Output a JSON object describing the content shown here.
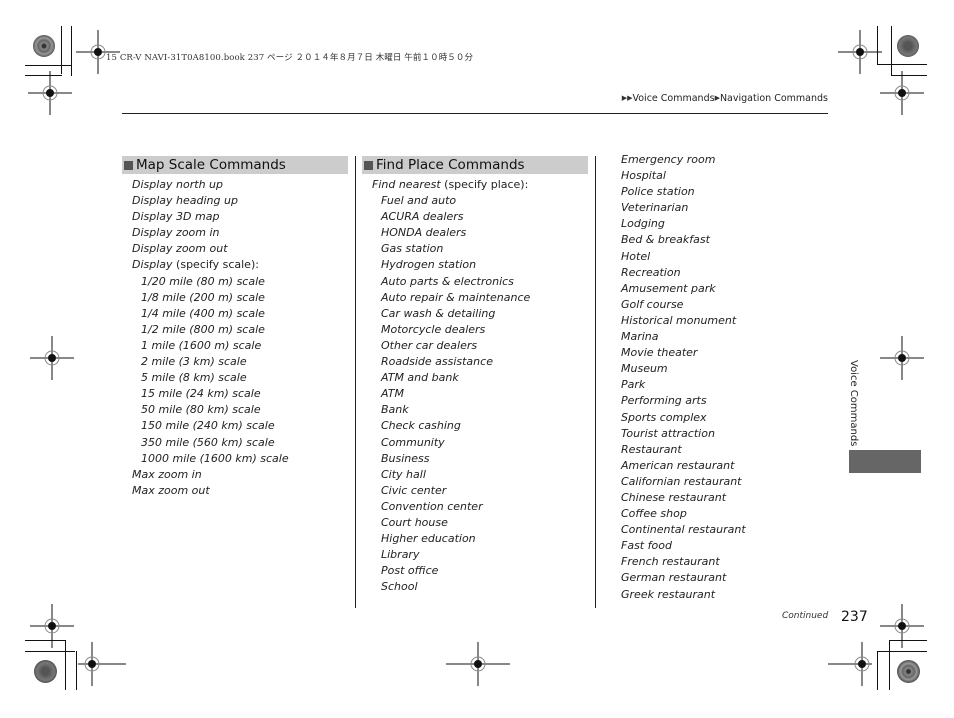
{
  "print_header": "15 CR-V NAVI-31T0A8100.book  237 ページ  ２０１４年８月７日  木曜日  午前１０時５０分",
  "breadcrumb": {
    "prefix_icon": "double-triangle-right-icon",
    "section": "Voice Commands",
    "separator_icon": "triangle-right-icon",
    "page": "Navigation Commands"
  },
  "columns": [
    {
      "heading": "Map Scale Commands",
      "items": [
        {
          "text": "Display north up",
          "level": 0
        },
        {
          "text": "Display heading up",
          "level": 0
        },
        {
          "text": "Display 3D map",
          "level": 0
        },
        {
          "text": "Display zoom in",
          "level": 0
        },
        {
          "text": "Display zoom out",
          "level": 0
        },
        {
          "text": "Display",
          "suffix": " (specify scale):",
          "level": 0
        },
        {
          "text": "1/20 mile (80 m) scale",
          "level": 1
        },
        {
          "text": "1/8 mile (200 m) scale",
          "level": 1
        },
        {
          "text": "1/4 mile (400 m) scale",
          "level": 1
        },
        {
          "text": "1/2 mile (800 m) scale",
          "level": 1
        },
        {
          "text": "1 mile (1600 m) scale",
          "level": 1
        },
        {
          "text": "2 mile (3 km) scale",
          "level": 1
        },
        {
          "text": "5 mile (8 km) scale",
          "level": 1
        },
        {
          "text": "15 mile (24 km) scale",
          "level": 1
        },
        {
          "text": "50 mile (80 km) scale",
          "level": 1
        },
        {
          "text": "150 mile (240 km) scale",
          "level": 1
        },
        {
          "text": "350 mile (560 km) scale",
          "level": 1
        },
        {
          "text": "1000 mile (1600 km) scale",
          "level": 1
        },
        {
          "text": "Max zoom in",
          "level": 0
        },
        {
          "text": "Max zoom out",
          "level": 0
        }
      ]
    },
    {
      "heading": "Find Place Commands",
      "items": [
        {
          "text": "Find nearest",
          "suffix": " (specify place):",
          "level": 0
        },
        {
          "text": "Fuel and auto",
          "level": 1
        },
        {
          "text": "ACURA dealers",
          "level": 1
        },
        {
          "text": "HONDA dealers",
          "level": 1
        },
        {
          "text": "Gas station",
          "level": 1
        },
        {
          "text": "Hydrogen station",
          "level": 1
        },
        {
          "text": "Auto parts & electronics",
          "level": 1
        },
        {
          "text": "Auto repair & maintenance",
          "level": 1
        },
        {
          "text": "Car wash & detailing",
          "level": 1
        },
        {
          "text": "Motorcycle dealers",
          "level": 1
        },
        {
          "text": "Other car dealers",
          "level": 1
        },
        {
          "text": "Roadside assistance",
          "level": 1
        },
        {
          "text": "ATM and bank",
          "level": 1
        },
        {
          "text": "ATM",
          "level": 1
        },
        {
          "text": "Bank",
          "level": 1
        },
        {
          "text": "Check cashing",
          "level": 1
        },
        {
          "text": "Community",
          "level": 1
        },
        {
          "text": "Business",
          "level": 1
        },
        {
          "text": "City hall",
          "level": 1
        },
        {
          "text": "Civic center",
          "level": 1
        },
        {
          "text": "Convention center",
          "level": 1
        },
        {
          "text": "Court house",
          "level": 1
        },
        {
          "text": "Higher education",
          "level": 1
        },
        {
          "text": "Library",
          "level": 1
        },
        {
          "text": "Post office",
          "level": 1
        },
        {
          "text": "School",
          "level": 1
        }
      ]
    },
    {
      "heading": "",
      "items": [
        {
          "text": "Emergency room",
          "level": 1
        },
        {
          "text": "Hospital",
          "level": 1
        },
        {
          "text": "Police station",
          "level": 1
        },
        {
          "text": "Veterinarian",
          "level": 1
        },
        {
          "text": "Lodging",
          "level": 1
        },
        {
          "text": "Bed & breakfast",
          "level": 1
        },
        {
          "text": "Hotel",
          "level": 1
        },
        {
          "text": "Recreation",
          "level": 1
        },
        {
          "text": "Amusement park",
          "level": 1
        },
        {
          "text": "Golf course",
          "level": 1
        },
        {
          "text": "Historical monument",
          "level": 1
        },
        {
          "text": "Marina",
          "level": 1
        },
        {
          "text": "Movie theater",
          "level": 1
        },
        {
          "text": "Museum",
          "level": 1
        },
        {
          "text": "Park",
          "level": 1
        },
        {
          "text": "Performing arts",
          "level": 1
        },
        {
          "text": "Sports complex",
          "level": 1
        },
        {
          "text": "Tourist attraction",
          "level": 1
        },
        {
          "text": "Restaurant",
          "level": 1
        },
        {
          "text": "American restaurant",
          "level": 1
        },
        {
          "text": "Californian restaurant",
          "level": 1
        },
        {
          "text": "Chinese restaurant",
          "level": 1
        },
        {
          "text": "Coffee shop",
          "level": 1
        },
        {
          "text": "Continental restaurant",
          "level": 1
        },
        {
          "text": "Fast food",
          "level": 1
        },
        {
          "text": "French restaurant",
          "level": 1
        },
        {
          "text": "German restaurant",
          "level": 1
        },
        {
          "text": "Greek restaurant",
          "level": 1
        }
      ]
    }
  ],
  "side_tab": {
    "label": "Voice Commands",
    "color": "#666666"
  },
  "footer": {
    "continued": "Continued",
    "page_number": "237"
  },
  "colors": {
    "heading_bg": "#cccccc",
    "heading_square": "#555555",
    "text": "#222222"
  }
}
